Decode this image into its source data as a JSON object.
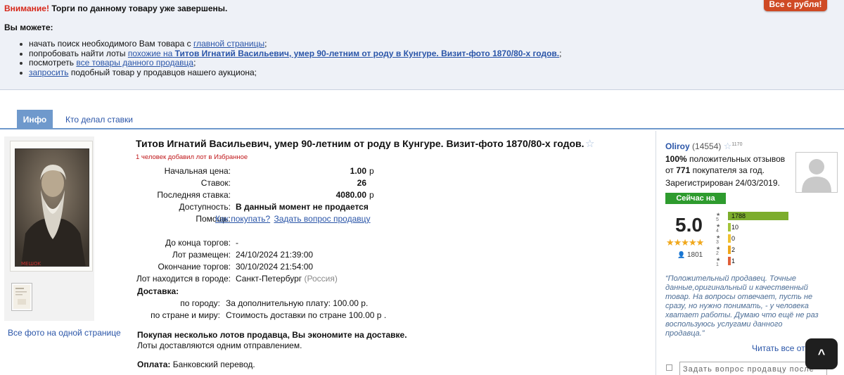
{
  "notice": {
    "warning_label": "Внимание!",
    "warning_text": "Торги по данному товару уже завершены.",
    "you_can": "Вы можете:",
    "items": [
      {
        "prefix": "начать поиск необходимого Вам товара с ",
        "link": "главной страницы",
        "suffix": ";"
      },
      {
        "prefix": "попробовать найти лоты ",
        "link": "похожие на",
        "link_bold": "Титов Игнатий Васильевич, умер 90-летним от роду в Кунгуре. Визит-фото 1870/80-х годов.",
        "suffix": ";"
      },
      {
        "prefix": "посмотреть ",
        "link": "все товары данного продавца",
        "suffix": ";"
      },
      {
        "prefix": "",
        "link": "запросить",
        "suffix": " подобный товар у продавцов нашего аукциона;"
      }
    ],
    "promo_button": "Все с рубля!"
  },
  "tabs": [
    {
      "label": "Инфо",
      "active": true
    },
    {
      "label": "Кто делал ставки",
      "active": false
    }
  ],
  "photos": {
    "watermark": "MEШOK",
    "all_photos_link": "Все фото на одной странице"
  },
  "lot": {
    "title": "Титов Игнатий Васильевич, умер 90-летним от роду в Кунгуре. Визит-фото 1870/80-х годов.",
    "favorite_note": "1 человек добавил лот в Избранное",
    "start_price_label": "Начальная цена:",
    "start_price": "1.00",
    "bids_label": "Ставок:",
    "bids": "26",
    "last_bid_label": "Последняя ставка:",
    "last_bid": "4080.00",
    "currency": "р",
    "availability_label": "Доступность:",
    "availability": "В данный момент не продается",
    "help_label": "Помощь:",
    "help_link1": "Как покупать?",
    "help_link2": "Задать вопрос продавцу",
    "ends_in_label": "До конца торгов:",
    "ends_in": "-",
    "placed_label": "Лот размещен:",
    "placed": "24/10/2024 21:39:00",
    "end_label": "Окончание торгов:",
    "end": "30/10/2024 21:54:00",
    "city_label": "Лот находится в городе:",
    "city": "Санкт-Петербург",
    "country": "(Россия)",
    "delivery_label": "Доставка:",
    "by_city_label": "по городу:",
    "by_city": "За дополнительную плату: 100.00 р.",
    "by_country_label": "по стране и миру:",
    "by_country": "Стоимость доставки по стране 100.00 р .",
    "save_note": "Покупая несколько лотов продавца, Вы экономите на доставке.",
    "save_sub": "Лоты доставляются одним отправлением.",
    "payment_label": "Оплата:",
    "payment": "Банковский перевод."
  },
  "seller": {
    "name": "Oliroy",
    "count": "(14554)",
    "star_count": "1170",
    "positive_pct": "100%",
    "positive_text": " положительных отзывов",
    "from_prefix": "от ",
    "from_num": "771",
    "from_suffix": " покупателя за год.",
    "registered": "Зарегистрирован 24/03/2019.",
    "online_badge": "Сейчас на сайте!",
    "score": "5.0",
    "votes": "1801",
    "rating_bars": [
      {
        "star": "5",
        "value": "1788",
        "fraction": 1.0,
        "color": "#7cad2c"
      },
      {
        "star": "4",
        "value": "10",
        "fraction": 0.01,
        "color": "#a4c43a"
      },
      {
        "star": "3",
        "value": "0",
        "fraction": 0.0,
        "color": "#f1c232"
      },
      {
        "star": "2",
        "value": "2",
        "fraction": 0.01,
        "color": "#f0a81c"
      },
      {
        "star": "1",
        "value": "1",
        "fraction": 0.01,
        "color": "#e0603a"
      }
    ],
    "review": "“Положительный продавец. Точные данные,оригинальный и качественный товар. На вопросы отвечает, пусть не сразу, но нужно понимать, - у человека хватает работы. Думаю что ещё не раз воспользуюсь услугами данного продавца.”",
    "read_all": "Читать все от",
    "ask_placeholder": "Задать вопрос продавцу после"
  }
}
